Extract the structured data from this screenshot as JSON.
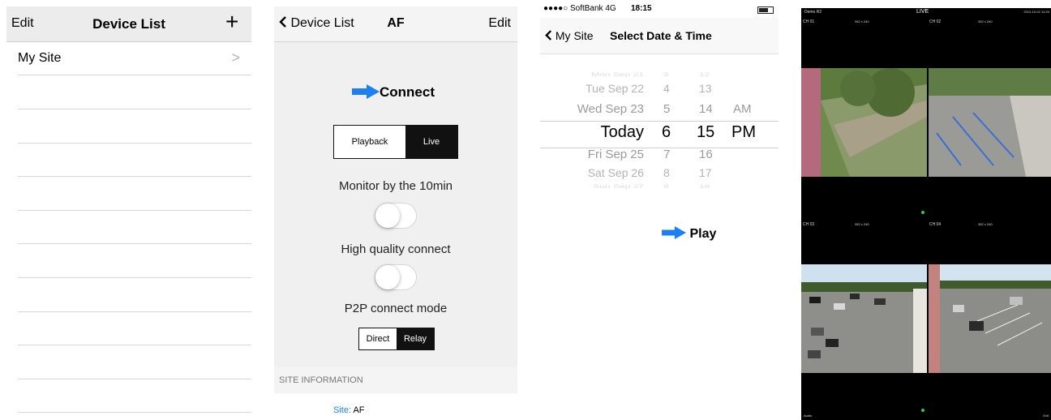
{
  "panel1": {
    "nav": {
      "edit": "Edit",
      "title": "Device List",
      "plus": "+"
    },
    "rows": [
      {
        "label": "My Site",
        "chevron": ">"
      }
    ]
  },
  "panel2": {
    "nav": {
      "back": "Device List",
      "title": "AF",
      "edit": "Edit"
    },
    "connect": "Connect",
    "mode_segment": {
      "options": [
        "Playback",
        "Live"
      ],
      "selected": "Live"
    },
    "monitor_label": "Monitor by the 10min",
    "monitor_on": false,
    "hq_label": "High quality connect",
    "hq_on": false,
    "p2p_label": "P2P connect mode",
    "p2p_segment": {
      "options": [
        "Direct",
        "Relay"
      ],
      "selected": "Relay"
    },
    "section_header": "SITE INFORMATION",
    "site_key": "Site:",
    "site_value": "AF"
  },
  "panel3": {
    "status": {
      "carrier": "●●●●○ SoftBank  4G",
      "time": "18:15"
    },
    "nav": {
      "back": "My Site",
      "title": "Select Date & Time"
    },
    "picker": {
      "dates": [
        "Mon Sep 21",
        "Tue Sep 22",
        "Wed Sep 23",
        "Today",
        "Fri Sep 25",
        "Sat Sep 26",
        "Sun Sep 27"
      ],
      "hours": [
        "3",
        "4",
        "5",
        "6",
        "7",
        "8",
        "9"
      ],
      "minutes": [
        "12",
        "13",
        "14",
        "15",
        "16",
        "17",
        "18"
      ],
      "ampm": [
        "AM",
        "PM"
      ],
      "selected": {
        "date": "Today",
        "hour": "6",
        "minute": "15",
        "ampm": "PM"
      }
    },
    "play": "Play"
  },
  "panel4": {
    "header": {
      "left": "Demo R2",
      "center": "LIVE",
      "right": "2012-10-02 14:20"
    },
    "channels": [
      {
        "label": "CH 01",
        "res": "352 x 240"
      },
      {
        "label": "CH 02",
        "res": "352 x 240"
      },
      {
        "label": "CH 03",
        "res": "352 x 240"
      },
      {
        "label": "CH 04",
        "res": "352 x 240"
      }
    ],
    "footer": {
      "left": "Audio",
      "right": "Exit"
    }
  },
  "colors": {
    "accent_blue": "#1e7ff0",
    "segment_dark": "#111111",
    "nav_gray": "#ececec",
    "live_green": "#2ecc40"
  }
}
